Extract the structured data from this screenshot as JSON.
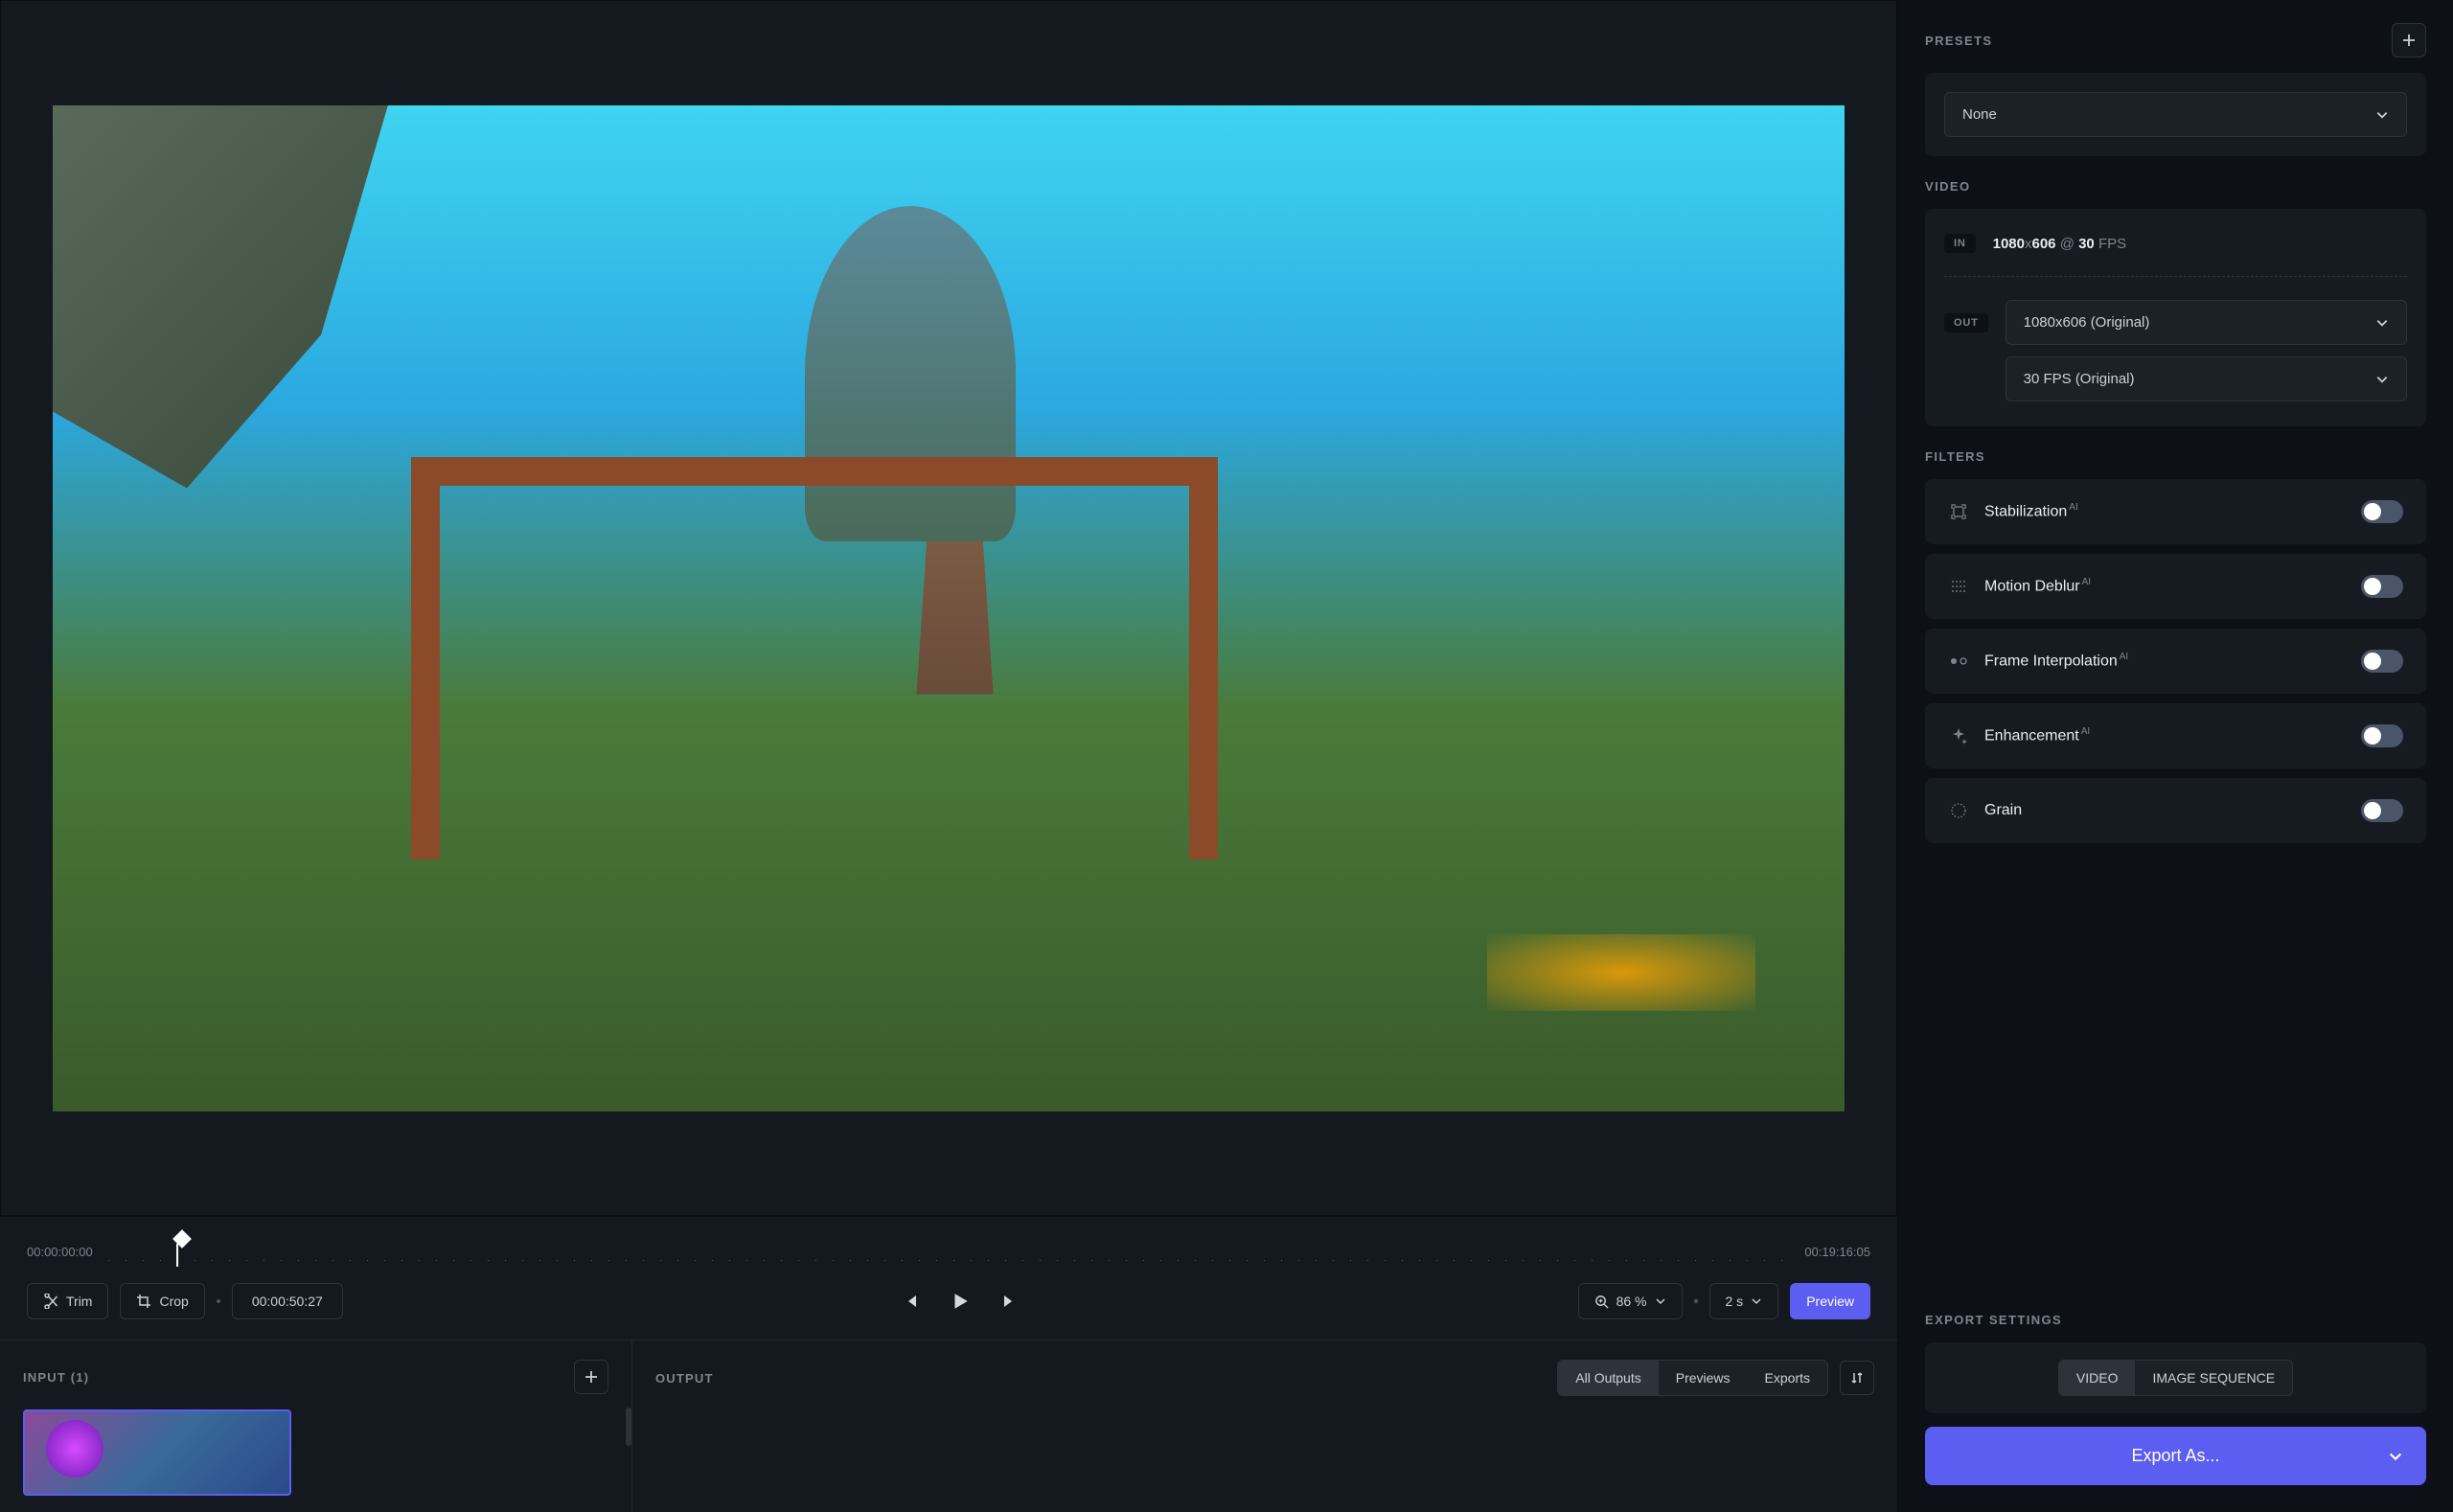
{
  "timeline": {
    "start": "00:00:00:00",
    "end": "00:19:16:05",
    "current": "00:00:50:27"
  },
  "toolbar": {
    "trim": "Trim",
    "crop": "Crop",
    "zoom_value": "86 %",
    "speed_value": "2 s",
    "preview": "Preview"
  },
  "panels": {
    "input_title": "INPUT (1)",
    "output_title": "OUTPUT",
    "tabs": {
      "all": "All Outputs",
      "previews": "Previews",
      "exports": "Exports"
    }
  },
  "sidebar": {
    "presets": {
      "title": "PRESETS",
      "selected": "None"
    },
    "video": {
      "title": "VIDEO",
      "in_badge": "IN",
      "out_badge": "OUT",
      "in_width": "1080",
      "in_height": "606",
      "in_fps": "30",
      "fps_label": "FPS",
      "out_resolution": "1080x606 (Original)",
      "out_fps": "30 FPS (Original)"
    },
    "filters": {
      "title": "FILTERS",
      "stabilization": "Stabilization",
      "motion_deblur": "Motion Deblur",
      "frame_interpolation": "Frame Interpolation",
      "enhancement": "Enhancement",
      "grain": "Grain",
      "ai_badge": "AI"
    },
    "export": {
      "title": "EXPORT SETTINGS",
      "tab_video": "VIDEO",
      "tab_image": "IMAGE SEQUENCE",
      "button": "Export As..."
    }
  }
}
